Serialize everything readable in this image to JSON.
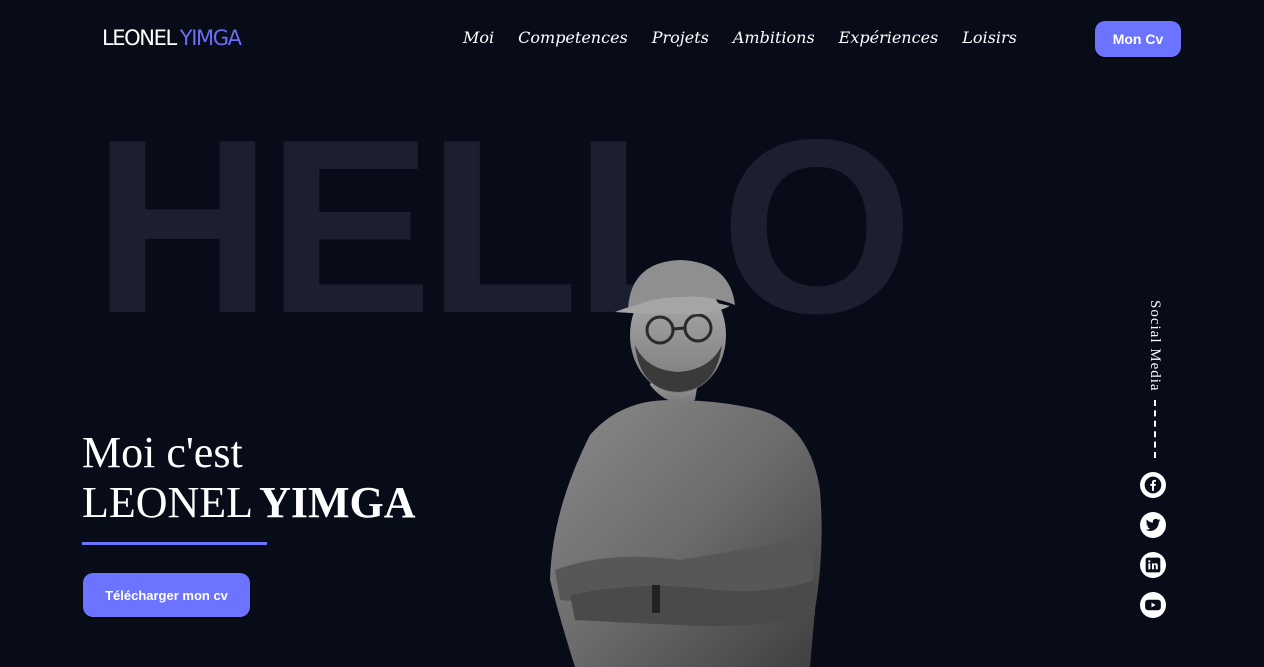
{
  "header": {
    "logo_first": "LEONEL",
    "logo_last": "YIMGA",
    "nav": [
      "Moi",
      "Competences",
      "Projets",
      "Ambitions",
      "Expériences",
      "Loisirs"
    ],
    "cv_button": "Mon Cv"
  },
  "hero": {
    "background_word": "HELLO",
    "intro_line1": "Moi c'est",
    "name_first": "LEONEL",
    "name_last": "YIMGA",
    "download_button": "Télécharger mon cv"
  },
  "social": {
    "label": "Social Media",
    "icons": [
      "facebook-icon",
      "twitter-icon",
      "linkedin-icon",
      "youtube-icon"
    ]
  },
  "colors": {
    "background": "#080b18",
    "accent": "#6b73ff",
    "hello_text": "#1c1f2f"
  }
}
